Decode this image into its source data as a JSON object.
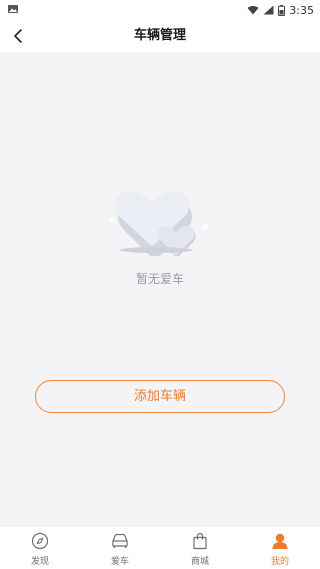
{
  "status_bar": {
    "time": "3:35"
  },
  "header": {
    "title": "车辆管理",
    "back_icon": "chevron-left-icon"
  },
  "empty_state": {
    "message": "暂无爱车",
    "illustration": "hearts-icon"
  },
  "actions": {
    "add_vehicle_label": "添加车辆"
  },
  "tab_bar": {
    "tabs": [
      {
        "label": "发现",
        "icon": "compass-icon",
        "active": false
      },
      {
        "label": "爱车",
        "icon": "car-icon",
        "active": false
      },
      {
        "label": "商城",
        "icon": "shopping-bag-icon",
        "active": false
      },
      {
        "label": "我的",
        "icon": "user-icon",
        "active": true
      }
    ]
  },
  "colors": {
    "accent": "#ee7a2a",
    "background": "#f4f4f6",
    "inactive": "#6e6e73"
  }
}
